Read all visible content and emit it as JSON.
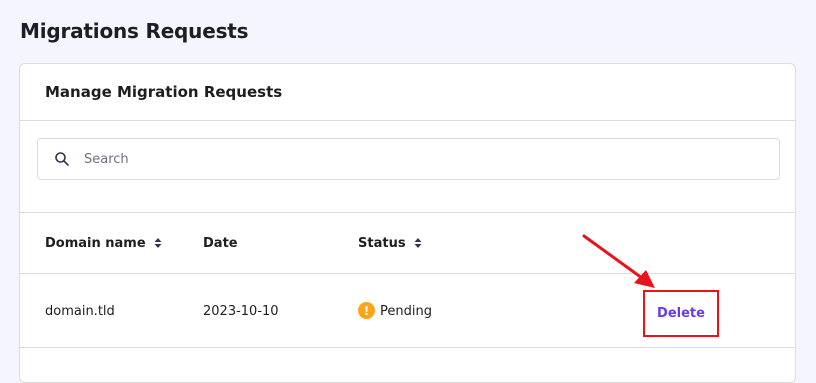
{
  "page": {
    "title": "Migrations Requests"
  },
  "card": {
    "title": "Manage Migration Requests"
  },
  "search": {
    "placeholder": "Search"
  },
  "table": {
    "columns": [
      {
        "label": "Domain name",
        "sortable": true
      },
      {
        "label": "Date",
        "sortable": false
      },
      {
        "label": "Status",
        "sortable": true
      }
    ],
    "rows": [
      {
        "domain": "domain.tld",
        "date": "2023-10-10",
        "status": "Pending",
        "action": "Delete"
      }
    ]
  },
  "colors": {
    "accent": "#673de6",
    "pending": "#fea419",
    "highlight": "#e8131b"
  },
  "icons": {
    "search": "search-icon",
    "sort": "sort-icon",
    "status": "warning-icon",
    "annotation": "arrow-icon"
  }
}
